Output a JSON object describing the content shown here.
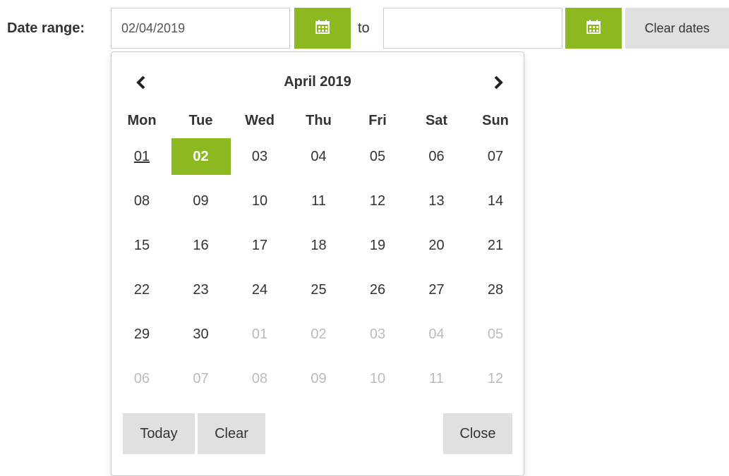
{
  "date_range": {
    "label": "Date range:",
    "start_value": "02/04/2019",
    "to_label": "to",
    "end_value": "",
    "clear_dates_label": "Clear dates",
    "accent_color": "#8cb920"
  },
  "calendar": {
    "month_title": "April 2019",
    "prev_icon": "chevron-left-icon",
    "next_icon": "chevron-right-icon",
    "weekdays": [
      "Mon",
      "Tue",
      "Wed",
      "Thu",
      "Fri",
      "Sat",
      "Sun"
    ],
    "weeks": [
      [
        "01",
        "02",
        "03",
        "04",
        "05",
        "06",
        "07"
      ],
      [
        "08",
        "09",
        "10",
        "11",
        "12",
        "13",
        "14"
      ],
      [
        "15",
        "16",
        "17",
        "18",
        "19",
        "20",
        "21"
      ],
      [
        "22",
        "23",
        "24",
        "25",
        "26",
        "27",
        "28"
      ],
      [
        "29",
        "30",
        "01",
        "02",
        "03",
        "04",
        "05"
      ],
      [
        "06",
        "07",
        "08",
        "09",
        "10",
        "11",
        "12"
      ]
    ],
    "today_day": "01",
    "selected_day": "02",
    "today_label": "Today",
    "clear_label": "Clear",
    "close_label": "Close"
  }
}
